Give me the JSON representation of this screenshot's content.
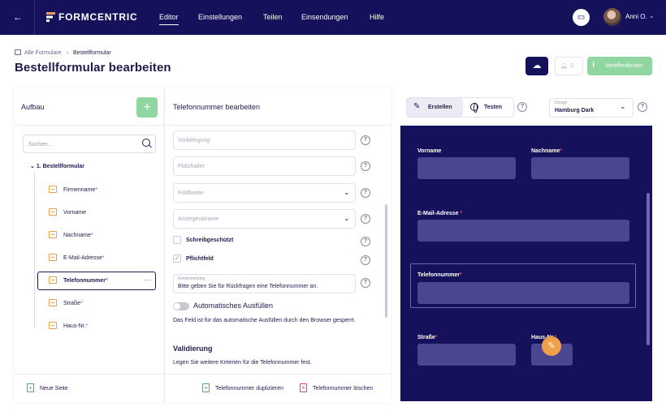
{
  "topbar": {
    "logo": "FORMCENTRIC",
    "nav": [
      {
        "label": "Editor",
        "active": true
      },
      {
        "label": "Einstellungen",
        "active": false
      },
      {
        "label": "Teilen",
        "active": false
      },
      {
        "label": "Einsendungen",
        "active": false
      },
      {
        "label": "Hilfe",
        "active": false
      }
    ],
    "user_name": "Anni O."
  },
  "breadcrumb": {
    "items": [
      "Alle Formulare",
      "Bestellformular"
    ],
    "separator": "›"
  },
  "page_title": "Bestellformular bearbeiten",
  "actions": {
    "notification_count": "0",
    "publish_label": "Veröffentlichen"
  },
  "structure": {
    "title": "Aufbau",
    "search_placeholder": "Suchen...",
    "page_label": "1. Bestellformular",
    "items": [
      {
        "label": "Firmenname",
        "required": "*"
      },
      {
        "label": "Vorname",
        "required": ""
      },
      {
        "label": "Nachname",
        "required": "*"
      },
      {
        "label": "E-Mail-Adresse",
        "required": "*"
      },
      {
        "label": "Telefonnummer",
        "required": "*"
      },
      {
        "label": "Straße",
        "required": "*"
      },
      {
        "label": "Haus-Nr.",
        "required": "*"
      }
    ],
    "new_page_label": "Neue Seite"
  },
  "editor": {
    "title": "Telefonnummer bearbeiten",
    "fields": {
      "default_value_placeholder": "Vorbelegung",
      "placeholder_placeholder": "Platzhalter",
      "width_placeholder": "Feldbreite",
      "variant_placeholder": "Anzeigevariante"
    },
    "readonly_label": "Schreibgeschützt",
    "required_label": "Pflichtfeld",
    "error_label": "Fehlermeldung",
    "error_value": "Bitte geben Sie für Rückfragen eine Telefonnummer an.",
    "autofill_label": "Automatisches Ausfüllen",
    "autofill_desc": "Das Feld ist für das automatische Ausfüllen durch den Browser gesperrt.",
    "validation_title": "Validierung",
    "validation_desc": "Legen Sie weitere Kriterien für die Telefonnummer fest.",
    "duplicate_label": "Telefonnummer duplizieren",
    "delete_label": "Telefonnummer löschen"
  },
  "preview": {
    "mode_create": "Erstellen",
    "mode_test": "Testen",
    "design_label": "Design",
    "design_value": "Hamburg Dark",
    "fields": {
      "vorname": {
        "label": "Vorname",
        "req": ""
      },
      "nachname": {
        "label": "Nachname",
        "req": "*"
      },
      "email": {
        "label": "E-Mail-Adresse",
        "req": " *"
      },
      "telefon": {
        "label": "Telefonnummer",
        "req": "*"
      },
      "strasse": {
        "label": "Straße",
        "req": "*"
      },
      "hausnr": {
        "label": "Haus-Nr.",
        "req": "*"
      }
    }
  },
  "colors": {
    "navy": "#15115a",
    "green": "#8fd6a1",
    "orange": "#f0a04b",
    "required": "#e0456a"
  }
}
